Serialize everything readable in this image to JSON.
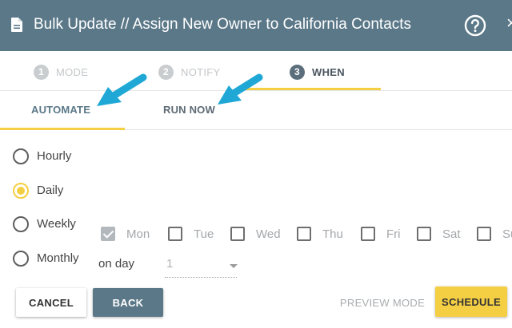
{
  "header": {
    "title": "Bulk Update // Assign New Owner to California Contacts",
    "close_glyph": "×"
  },
  "steps": [
    {
      "number": "1",
      "label": "MODE",
      "state": "disabled"
    },
    {
      "number": "2",
      "label": "NOTIFY",
      "state": "disabled"
    },
    {
      "number": "3",
      "label": "WHEN",
      "state": "active"
    }
  ],
  "tabs": [
    {
      "label": "AUTOMATE",
      "selected": true
    },
    {
      "label": "RUN NOW",
      "selected": false
    }
  ],
  "frequency": {
    "options": [
      {
        "label": "Hourly",
        "checked": false
      },
      {
        "label": "Daily",
        "checked": true
      },
      {
        "label": "Weekly",
        "checked": false
      },
      {
        "label": "Monthly",
        "checked": false
      }
    ]
  },
  "days": [
    {
      "label": "Mon",
      "checked": true
    },
    {
      "label": "Tue",
      "checked": false
    },
    {
      "label": "Wed",
      "checked": false
    },
    {
      "label": "Thu",
      "checked": false
    },
    {
      "label": "Fri",
      "checked": false
    },
    {
      "label": "Sat",
      "checked": false
    },
    {
      "label": "Sun",
      "checked": false
    }
  ],
  "monthly": {
    "on_day_label": "on day",
    "day_value": "1"
  },
  "footer": {
    "cancel_label": "CANCEL",
    "back_label": "BACK",
    "preview_label": "PREVIEW MODE",
    "schedule_label": "SCHEDULE"
  },
  "colors": {
    "header_bg": "#5b7888",
    "accent_yellow": "#f5cf43",
    "annotation_arrow": "#1fa8d6"
  },
  "icons": {
    "doc": "document-icon",
    "help": "help-circle-icon",
    "close": "close-icon"
  }
}
